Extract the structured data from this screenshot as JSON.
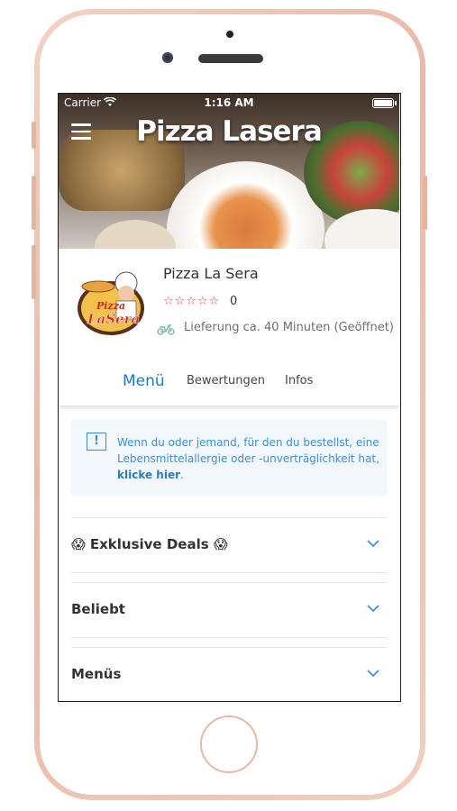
{
  "status_bar": {
    "carrier": "Carrier",
    "time": "1:16 AM"
  },
  "header": {
    "title": "Pizza Lasera"
  },
  "restaurant": {
    "name": "Pizza La Sera",
    "logo_text": "Pizza LaSera",
    "rating_stars": "☆☆☆☆☆",
    "rating_count": "0",
    "delivery": "Lieferung ca. 40 Minuten (Geöffnet)"
  },
  "tabs": [
    {
      "label": "Menü",
      "active": true
    },
    {
      "label": "Bewertungen",
      "active": false
    },
    {
      "label": "Infos",
      "active": false
    }
  ],
  "notice": {
    "text": "Wenn du oder jemand, für den du bestellst, eine Lebensmittelallergie oder -unverträglichkeit hat,",
    "link": "klicke hier",
    "suffix": "."
  },
  "categories": [
    {
      "label": "😱 Exklusive Deals 😱"
    },
    {
      "label": "Beliebt"
    },
    {
      "label": "Menüs"
    }
  ],
  "colors": {
    "accent": "#1f7ac2",
    "star": "#d14b47",
    "notice_bg": "#f2f7fb"
  }
}
